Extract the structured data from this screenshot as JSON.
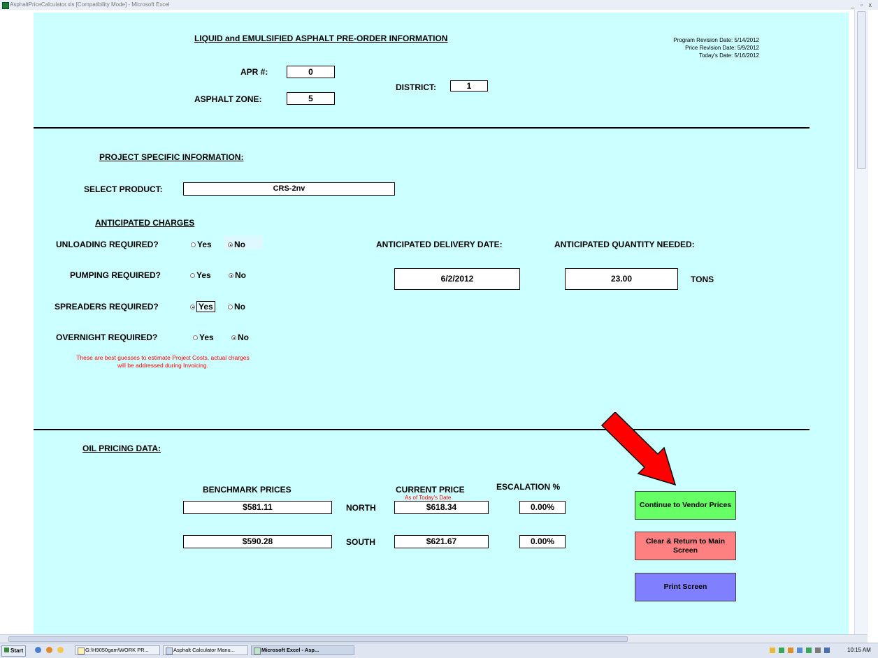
{
  "window": {
    "title": "AsphaltPriceCalculator.xls [Compatibility Mode] - Microsoft Excel",
    "controls": "_ ▫ x"
  },
  "header": {
    "title": "LIQUID and EMULSIFIED ASPHALT PRE-ORDER INFORMATION",
    "program_revision": "Program Revision Date: 5/14/2012",
    "price_revision": "Price Revision Date: 5/9/2012",
    "todays_date": "Today's Date: 5/16/2012",
    "apr_label": "APR #:",
    "apr_value": "0",
    "zone_label": "ASPHALT ZONE:",
    "zone_value": "5",
    "district_label": "DISTRICT:",
    "district_value": "1"
  },
  "project": {
    "section_title": "PROJECT SPECIFIC INFORMATION:",
    "product_label": "SELECT PRODUCT:",
    "product_value": "CRS-2nv",
    "charges_title": "ANTICIPATED CHARGES",
    "yes_label": "Yes",
    "no_label": "No",
    "charges": [
      {
        "label": "UNLOADING REQUIRED?",
        "selected": "No"
      },
      {
        "label": "PUMPING REQUIRED?",
        "selected": "No"
      },
      {
        "label": "SPREADERS REQUIRED?",
        "selected": "Yes"
      },
      {
        "label": "OVERNIGHT REQUIRED?",
        "selected": "No"
      }
    ],
    "note_line1": "These are best guesses to estimate Project Costs, actual charges",
    "note_line2": "will be addressed during Invoicing.",
    "delivery_label": "ANTICIPATED DELIVERY DATE:",
    "delivery_value": "6/2/2012",
    "quantity_label": "ANTICIPATED QUANTITY NEEDED:",
    "quantity_value": "23.00",
    "quantity_unit": "TONS"
  },
  "pricing": {
    "section_title": "OIL PRICING DATA:",
    "benchmark_header": "BENCHMARK PRICES",
    "current_header": "CURRENT PRICE",
    "current_subheader": "As of Today's Date",
    "escalation_header": "ESCALATION %",
    "rows": [
      {
        "region": "NORTH",
        "benchmark": "$581.11",
        "current": "$618.34",
        "escalation": "0.00%"
      },
      {
        "region": "SOUTH",
        "benchmark": "$590.28",
        "current": "$621.67",
        "escalation": "0.00%"
      }
    ]
  },
  "buttons": {
    "continue": "Continue to Vendor Prices",
    "clear": "Clear & Return to Main Screen",
    "print": "Print Screen"
  },
  "colors": {
    "sheet_bg": "#ccffff",
    "continue_btn": "#66ff66",
    "clear_btn": "#ff8080",
    "print_btn": "#8080ff",
    "note_text": "#ff0000",
    "arrow": "#ff0000"
  },
  "taskbar": {
    "start": "Start",
    "tasks": [
      "G:\\H9050gam\\WORK PR...",
      "Asphalt Calculator Manu...",
      "Microsoft Excel - Asp..."
    ],
    "clock": "10:15 AM"
  }
}
